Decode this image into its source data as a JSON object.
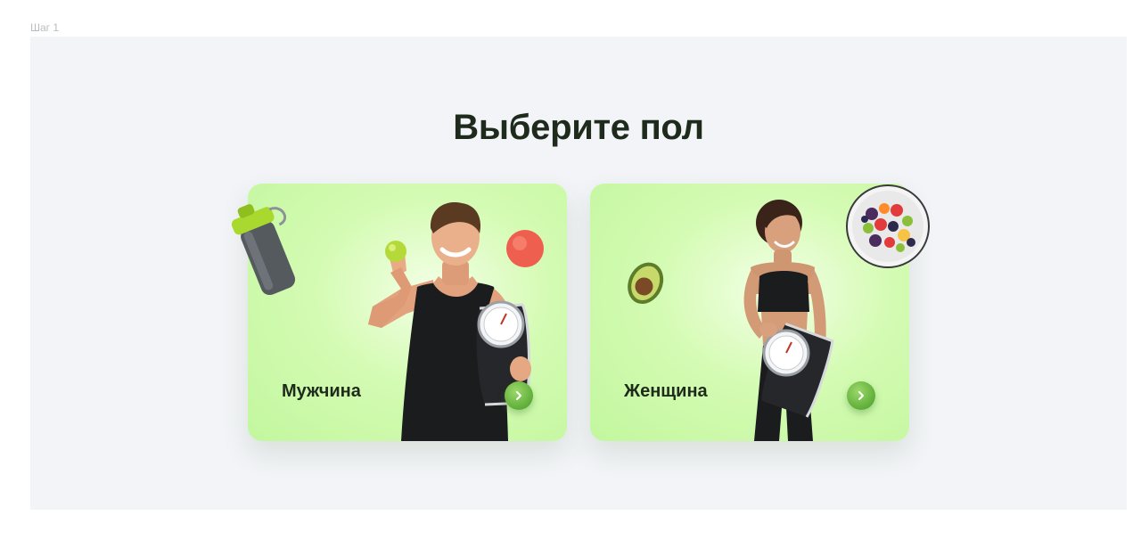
{
  "step_label": "Шаг 1",
  "title": "Выберите пол",
  "cards": [
    {
      "label": "Мужчина",
      "arrow_icon": "chevron-right-icon"
    },
    {
      "label": "Женщина",
      "arrow_icon": "chevron-right-icon"
    }
  ],
  "colors": {
    "card_bg": "#c2f79e",
    "accent": "#5fae3a",
    "title": "#1e2a1b",
    "frame_bg": "#f2f4f7"
  }
}
